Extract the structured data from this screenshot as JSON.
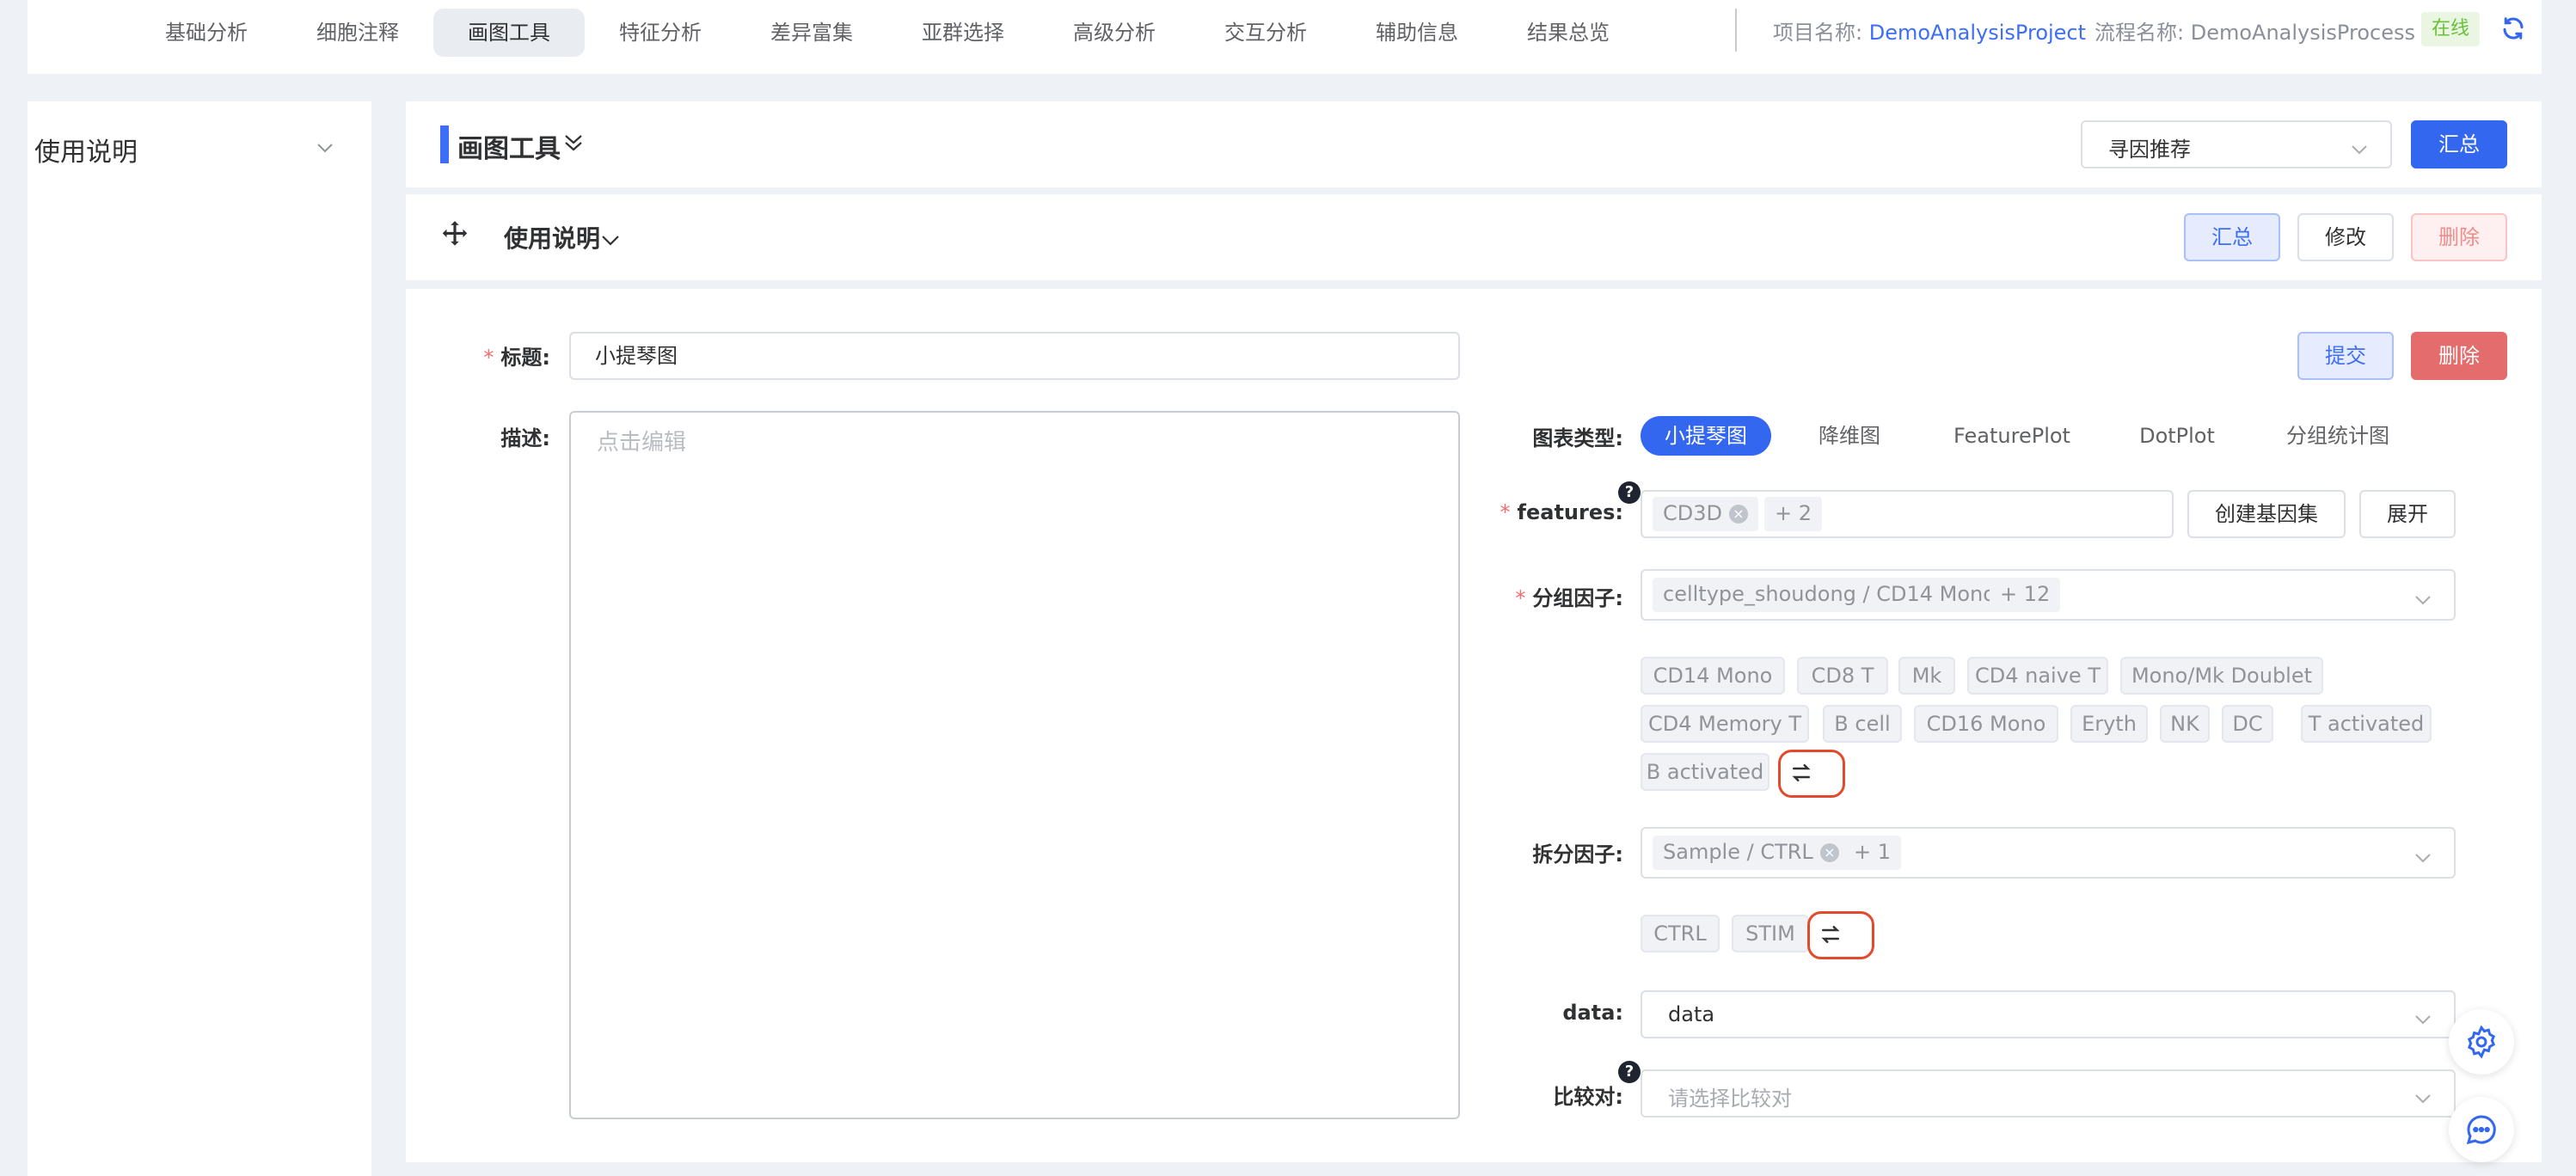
{
  "nav": {
    "items": [
      "基础分析",
      "细胞注释",
      "画图工具",
      "特征分析",
      "差异富集",
      "亚群选择",
      "高级分析",
      "交互分析",
      "辅助信息",
      "结果总览"
    ],
    "active_index": 2,
    "project_label": "项目名称:",
    "project_value": "DemoAnalysisProject",
    "process_label": "流程名称:",
    "process_value": "DemoAnalysisProcess",
    "status": "在线"
  },
  "sidebar": {
    "title": "使用说明"
  },
  "header": {
    "title": "画图工具",
    "recommend_select": "寻因推荐",
    "summary_button": "汇总"
  },
  "section": {
    "title": "使用说明",
    "summary_button": "汇总",
    "edit_button": "修改",
    "delete_button": "删除"
  },
  "form": {
    "title_label": "标题:",
    "title_value": "小提琴图",
    "desc_label": "描述:",
    "desc_placeholder": "点击编辑",
    "submit_button": "提交",
    "delete_button": "删除",
    "chart_type_label": "图表类型:",
    "chart_types": [
      "小提琴图",
      "降维图",
      "FeaturePlot",
      "DotPlot",
      "分组统计图"
    ],
    "chart_type_active": 0,
    "features_label": "features:",
    "features_tag": "CD3D",
    "features_more": "+ 2",
    "create_geneset_button": "创建基因集",
    "expand_button": "展开",
    "group_label": "分组因子:",
    "group_tag": "celltype_shoudong / CD14 Mono",
    "group_more": "+ 12",
    "group_values": [
      "CD14 Mono",
      "CD8 T",
      "Mk",
      "CD4 naive T",
      "Mono/Mk Doublet",
      "CD4 Memory T",
      "B cell",
      "CD16 Mono",
      "Eryth",
      "NK",
      "DC",
      "T activated",
      "B activated"
    ],
    "split_label": "拆分因子:",
    "split_tag": "Sample / CTRL",
    "split_more": "+ 1",
    "split_values": [
      "CTRL",
      "STIM"
    ],
    "data_label": "data:",
    "data_value": "data",
    "compare_label": "比较对:",
    "compare_placeholder": "请选择比较对"
  },
  "colors": {
    "primary": "#3467f0",
    "danger": "#e46c6c",
    "online": "#67c23a",
    "highlight_ring": "#e34a2c"
  }
}
